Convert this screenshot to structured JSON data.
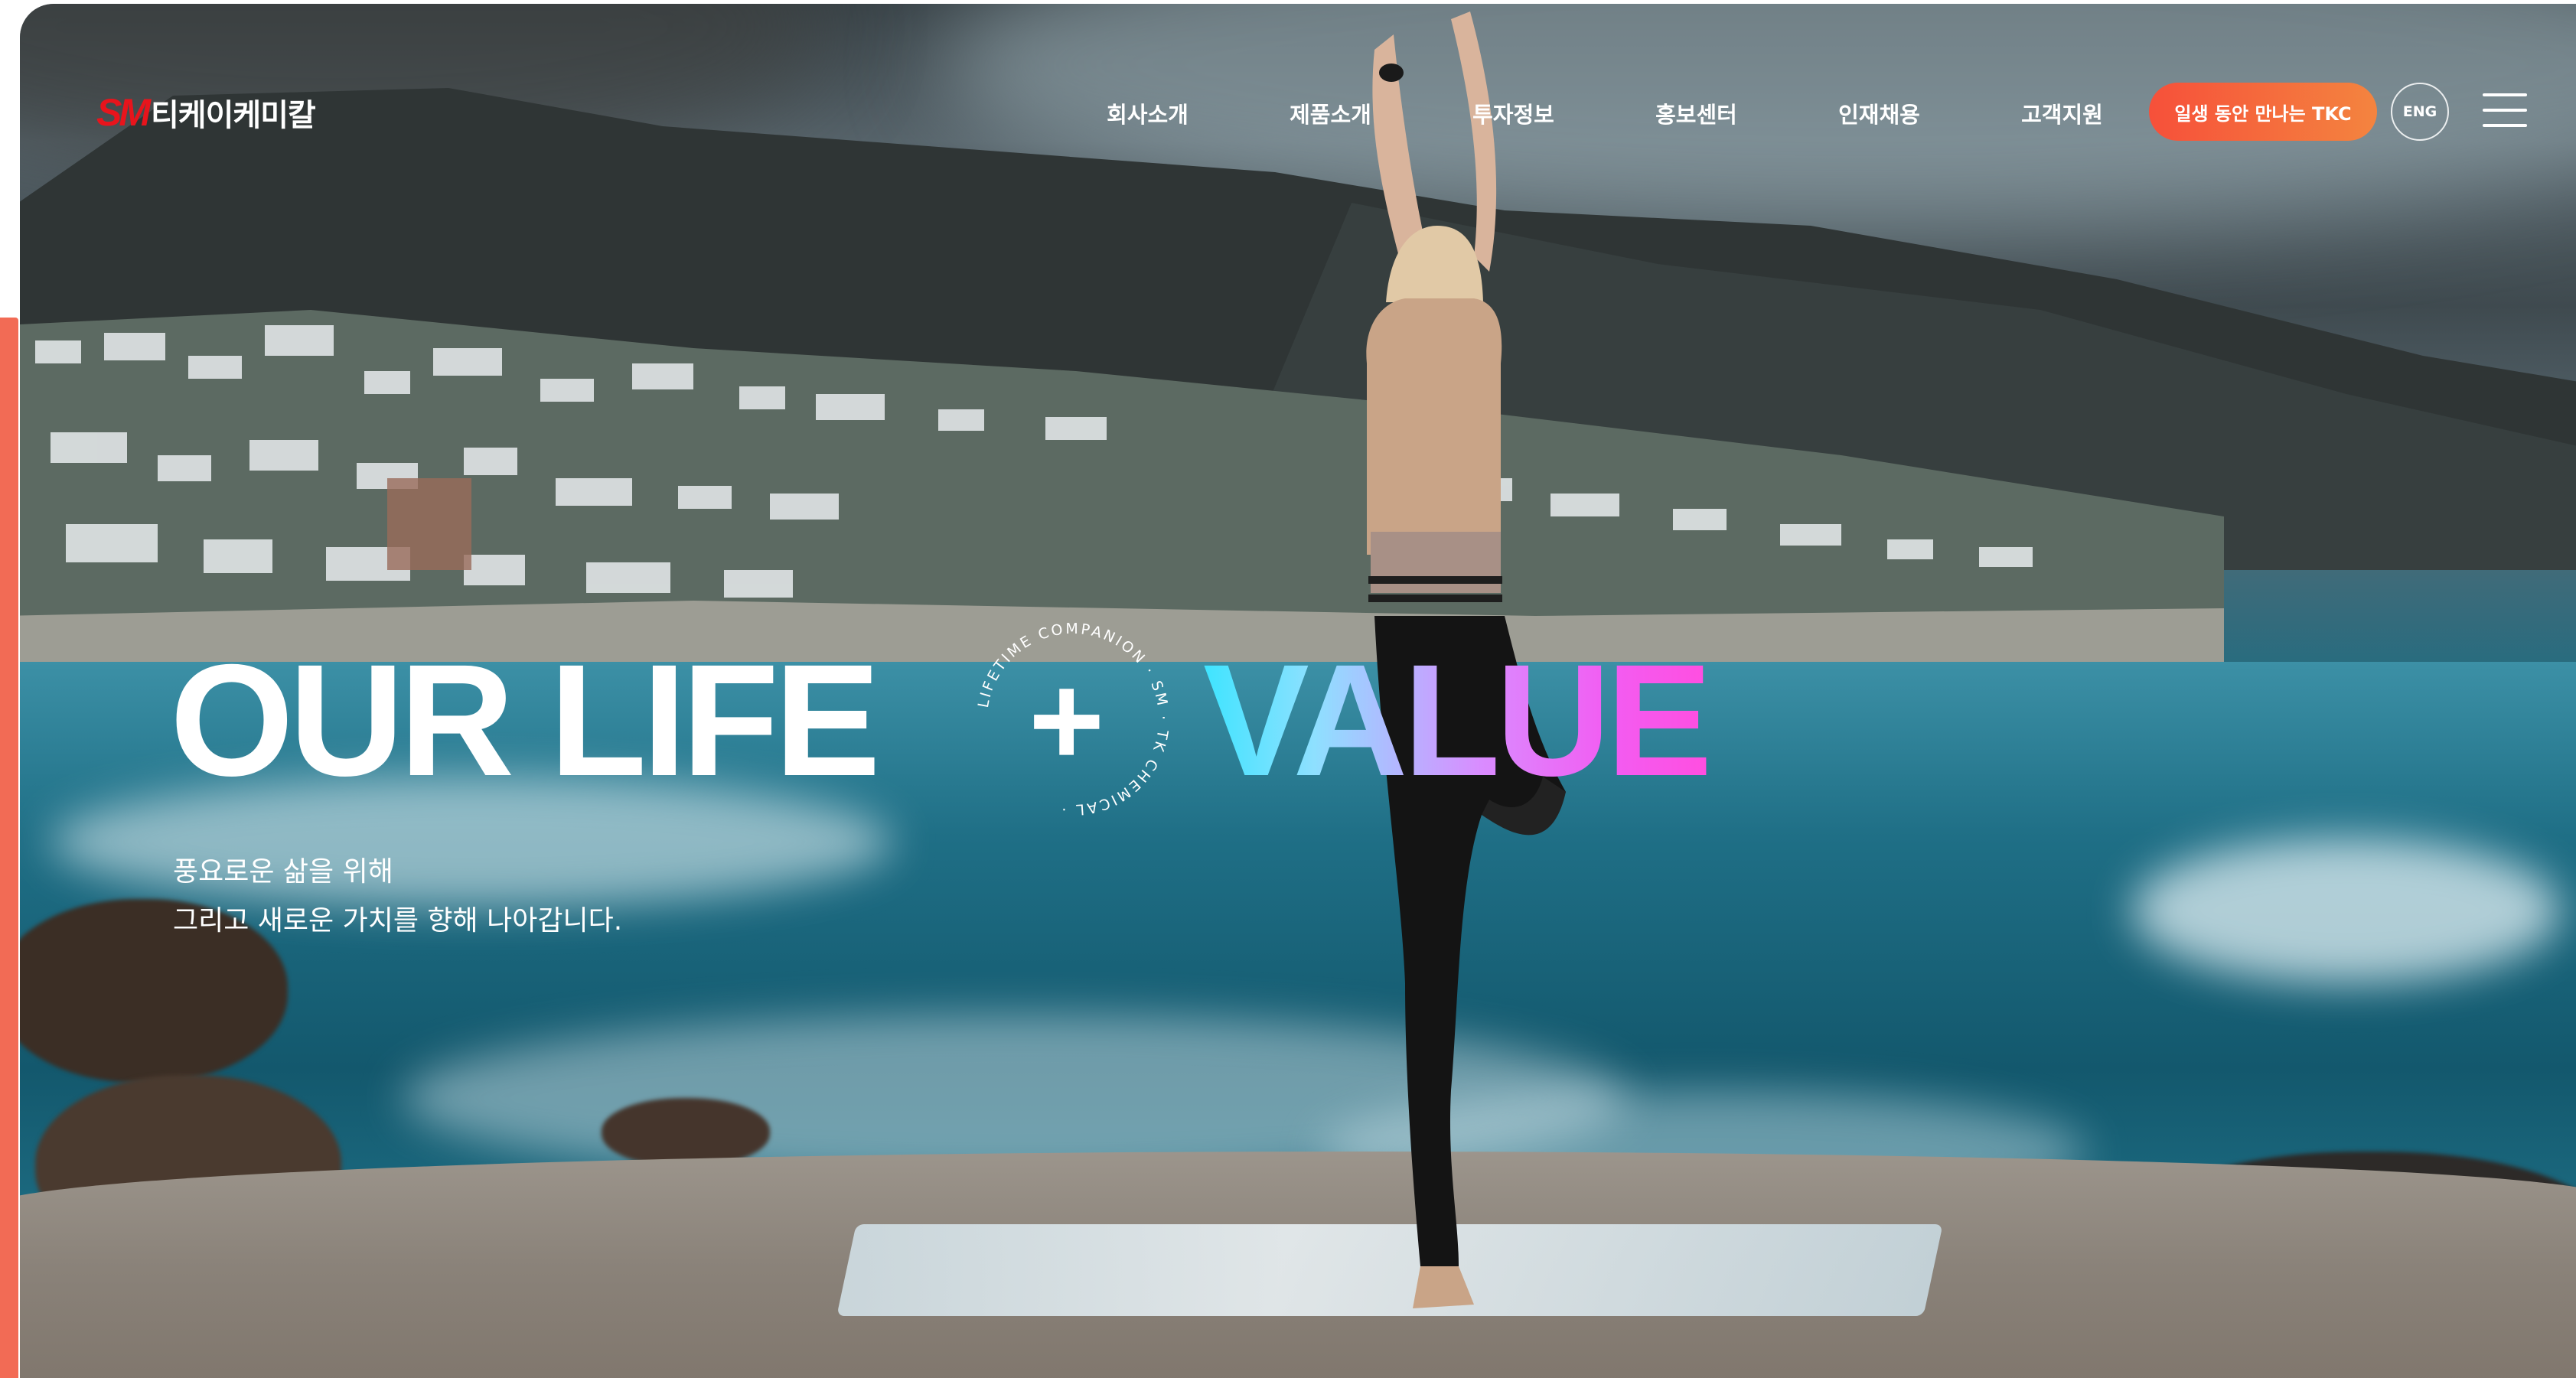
{
  "header": {
    "logo_mark": "SM",
    "logo_text": "티케이케미칼",
    "nav": [
      "회사소개",
      "제품소개",
      "투자정보",
      "홍보센터",
      "인재채용",
      "고객지원"
    ],
    "cta_label": "일생 동안 만나는 TKC",
    "lang_label": "ENG"
  },
  "hero": {
    "headline_left": "OUR LIFE",
    "headline_plus": "+",
    "headline_right": "VALUE",
    "badge_ring_text": "LIFETIME COMPANION · SM · TK CHEMICAL ·",
    "subtitle_lines": [
      "풍요로운 삶을 위해",
      "그리고 새로운 가치를 향해 나아갑니다."
    ]
  },
  "colors": {
    "accent": "#f26b55",
    "cta_start": "#f6503a",
    "cta_end": "#f4843f",
    "value_gradient": [
      "#3ee4ff",
      "#d98cff",
      "#ff4ee0"
    ],
    "logo_red": "#e8141c"
  },
  "icons": {
    "menu": "hamburger-icon"
  }
}
